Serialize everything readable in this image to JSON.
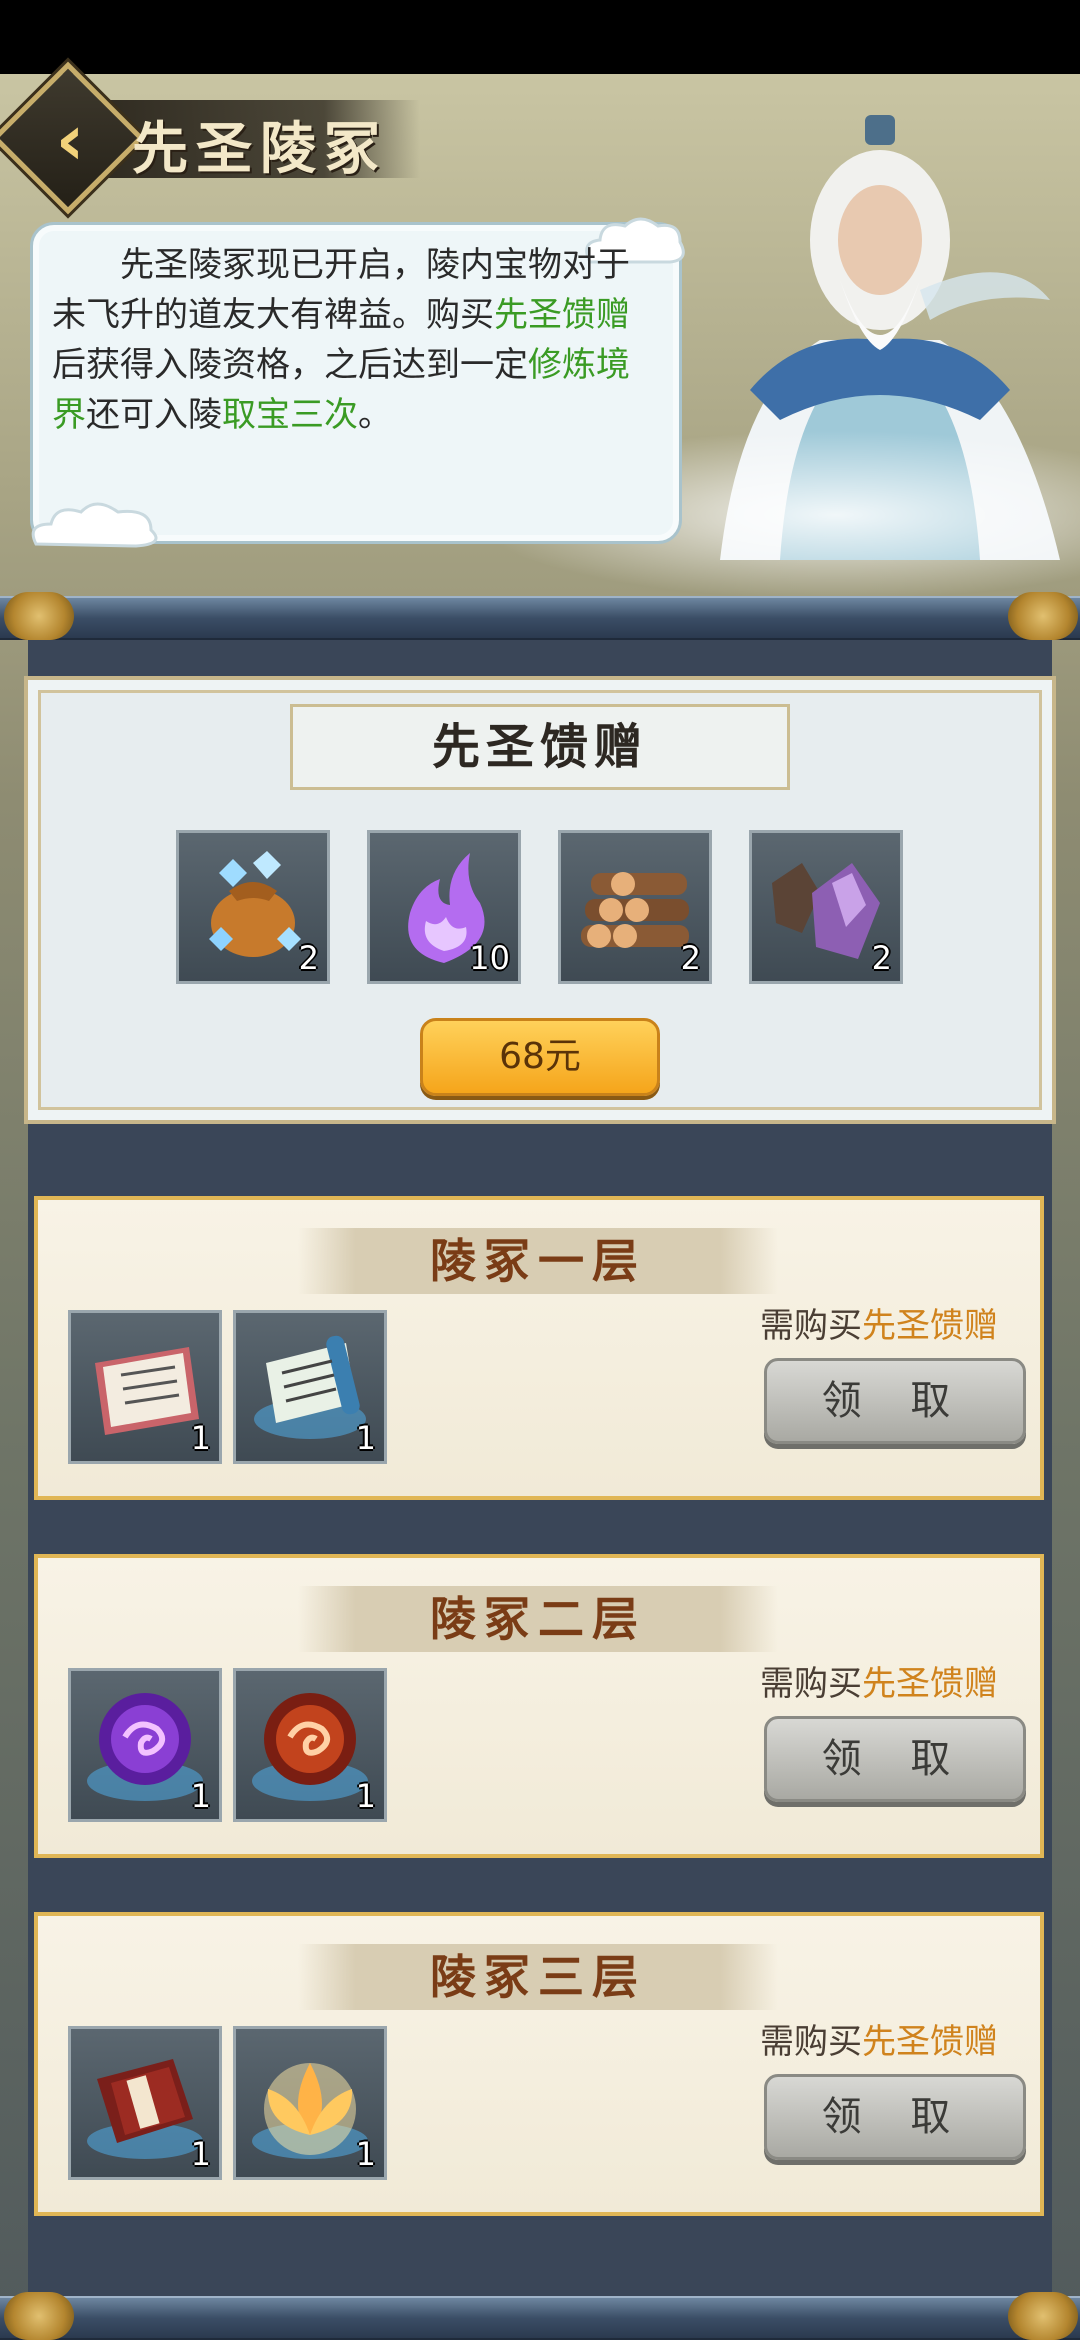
{
  "header": {
    "title": "先圣陵冢"
  },
  "intro": {
    "text": {
      "p1": "先圣陵冢现已开启，陵内宝物对于未飞升的道友大有裨益。购买",
      "link1": "先圣馈赠",
      "p2": "后获得入陵资格，之后达到一定",
      "link2": "修炼境界",
      "p3": "还可入陵",
      "link3": "取宝三次",
      "p4": "。"
    }
  },
  "gift": {
    "title": "先圣馈赠",
    "items": [
      {
        "name": "spirit-stone-bag",
        "count": "2"
      },
      {
        "name": "purple-flame",
        "count": "10"
      },
      {
        "name": "wood-logs",
        "count": "2"
      },
      {
        "name": "purple-ore",
        "count": "2"
      }
    ],
    "price": "68元"
  },
  "tiers": [
    {
      "title": "陵冢一层",
      "requirement_prefix": "需购买",
      "requirement_link": "先圣馈赠",
      "claim": "领 取",
      "items": [
        {
          "name": "paper-note",
          "count": "1"
        },
        {
          "name": "blue-scroll",
          "count": "1"
        }
      ]
    },
    {
      "title": "陵冢二层",
      "requirement_prefix": "需购买",
      "requirement_link": "先圣馈赠",
      "claim": "领 取",
      "items": [
        {
          "name": "purple-orb",
          "count": "1"
        },
        {
          "name": "red-orb",
          "count": "1"
        }
      ]
    },
    {
      "title": "陵冢三层",
      "requirement_prefix": "需购买",
      "requirement_link": "先圣馈赠",
      "claim": "领 取",
      "items": [
        {
          "name": "red-book",
          "count": "1"
        },
        {
          "name": "lotus",
          "count": "1"
        }
      ]
    }
  ],
  "colors": {
    "accent_green": "#3a9b24",
    "accent_orange": "#d0831d",
    "gold": "#f5a51b"
  }
}
